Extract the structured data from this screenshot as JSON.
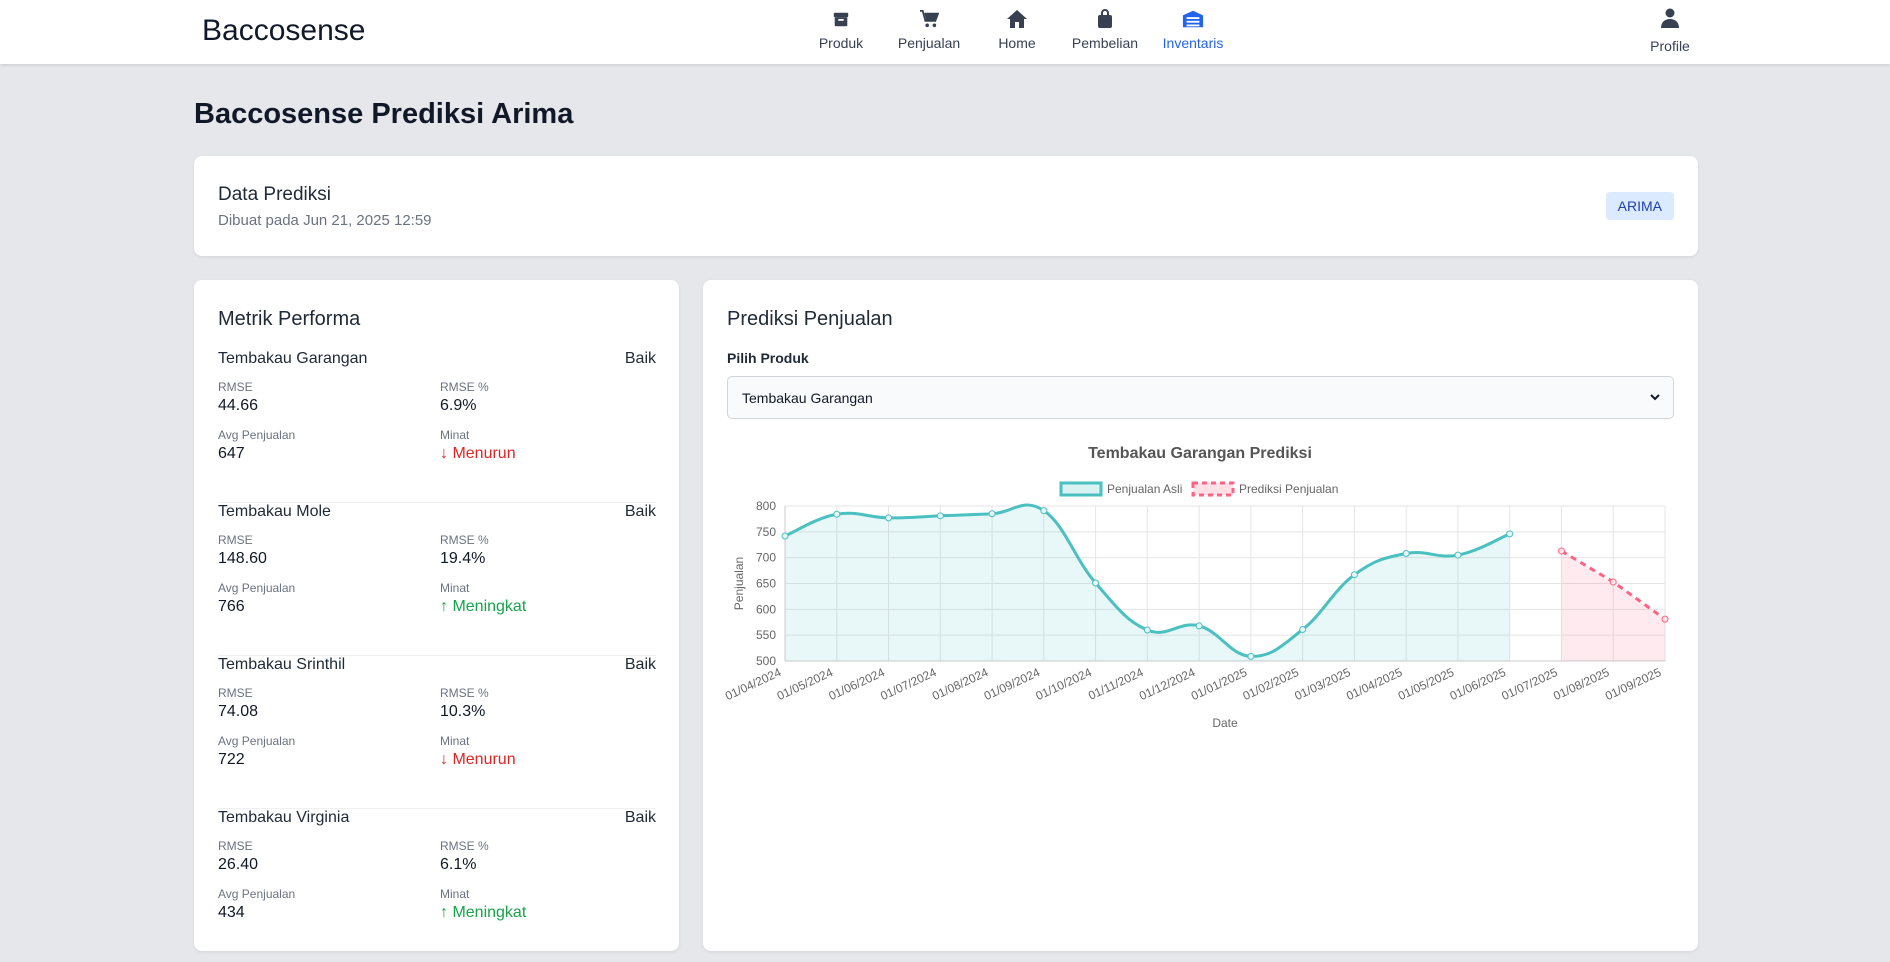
{
  "app": {
    "brand": "Baccosense"
  },
  "nav": {
    "items": [
      {
        "label": "Produk",
        "icon": "box-icon"
      },
      {
        "label": "Penjualan",
        "icon": "cart-icon"
      },
      {
        "label": "Home",
        "icon": "home-icon"
      },
      {
        "label": "Pembelian",
        "icon": "bag-icon"
      },
      {
        "label": "Inventaris",
        "icon": "warehouse-icon"
      }
    ],
    "active": "Inventaris",
    "active_color": "#2563eb",
    "profile_label": "Profile"
  },
  "page": {
    "title": "Baccosense Prediksi Arima"
  },
  "info": {
    "title": "Data Prediksi",
    "created": "Dibuat pada Jun 21, 2025 12:59",
    "badge": "ARIMA"
  },
  "metrics": {
    "title": "Metrik Performa",
    "rmse_label": "RMSE",
    "rmse_pct_label": "RMSE %",
    "avg_label": "Avg Penjualan",
    "trend_label": "Minat",
    "items": [
      {
        "name": "Tembakau Garangan",
        "status": "Baik",
        "rmse": "44.66",
        "rmse_pct": "6.9%",
        "avg": "647",
        "trend": "↓ Menurun",
        "trend_dir": "down"
      },
      {
        "name": "Tembakau Mole",
        "status": "Baik",
        "rmse": "148.60",
        "rmse_pct": "19.4%",
        "avg": "766",
        "trend": "↑ Meningkat",
        "trend_dir": "up"
      },
      {
        "name": "Tembakau Srinthil",
        "status": "Baik",
        "rmse": "74.08",
        "rmse_pct": "10.3%",
        "avg": "722",
        "trend": "↓ Menurun",
        "trend_dir": "down"
      },
      {
        "name": "Tembakau Virginia",
        "status": "Baik",
        "rmse": "26.40",
        "rmse_pct": "6.1%",
        "avg": "434",
        "trend": "↑ Meningkat",
        "trend_dir": "up"
      }
    ]
  },
  "prediction": {
    "title": "Prediksi Penjualan",
    "select_label": "Pilih Produk",
    "selected_product": "Tembakau Garangan"
  },
  "chart_data": {
    "type": "line",
    "title": "Tembakau Garangan Prediksi",
    "xlabel": "Date",
    "ylabel": "Penjualan",
    "ylim": [
      500,
      800
    ],
    "yticks": [
      500,
      550,
      600,
      650,
      700,
      750,
      800
    ],
    "grid": true,
    "legend_position": "top",
    "categories": [
      "01/04/2024",
      "01/05/2024",
      "01/06/2024",
      "01/07/2024",
      "01/08/2024",
      "01/09/2024",
      "01/10/2024",
      "01/11/2024",
      "01/12/2024",
      "01/01/2025",
      "01/02/2025",
      "01/03/2025",
      "01/04/2025",
      "01/05/2025",
      "01/06/2025",
      "01/07/2025",
      "01/08/2025",
      "01/09/2025"
    ],
    "series": [
      {
        "name": "Penjualan Asli",
        "color": "#4bc0c0",
        "style": "solid",
        "values": [
          742,
          784,
          777,
          781,
          785,
          791,
          651,
          560,
          568,
          509,
          561,
          667,
          708,
          705,
          746,
          null,
          null,
          null
        ]
      },
      {
        "name": "Prediksi Penjualan",
        "color": "#ff6384",
        "style": "dashed",
        "values": [
          null,
          null,
          null,
          null,
          null,
          null,
          null,
          null,
          null,
          null,
          null,
          null,
          null,
          null,
          null,
          713,
          653,
          581
        ]
      }
    ]
  }
}
